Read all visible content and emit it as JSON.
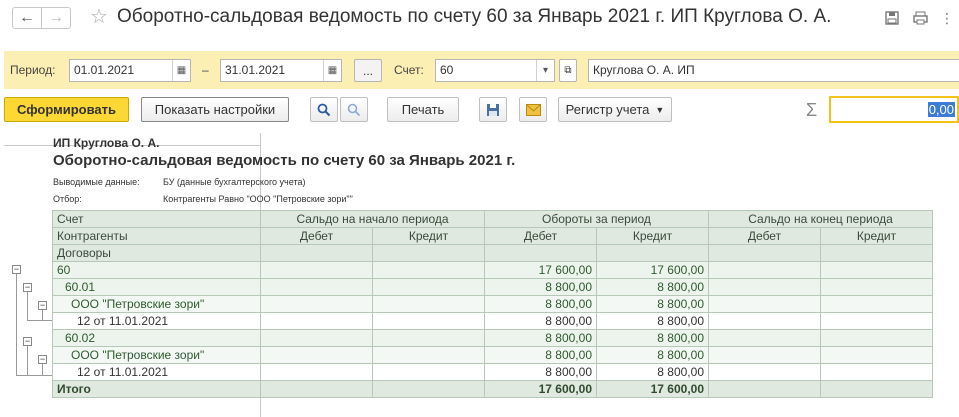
{
  "window": {
    "title": "Оборотно-сальдовая ведомость по счету 60 за Январь 2021 г. ИП Круглова О. А."
  },
  "params": {
    "period_label": "Период:",
    "date_from": "01.01.2021",
    "dash": "–",
    "date_to": "31.01.2021",
    "more_label": "...",
    "account_label": "Счет:",
    "account_value": "60",
    "organization": "Круглова О. А. ИП"
  },
  "toolbar": {
    "generate_label": "Сформировать",
    "show_settings_label": "Показать настройки",
    "print_label": "Печать",
    "register_label": "Регистр учета",
    "sum_value": "0,00"
  },
  "report": {
    "org": "ИП Круглова О. А.",
    "title": "Оборотно-сальдовая ведомость по счету 60 за Январь 2021 г.",
    "output_label": "Выводимые данные:",
    "output_value": "БУ (данные бухгалтерского учета)",
    "filter_label": "Отбор:",
    "filter_value": "Контрагенты Равно \"ООО \"Петровские зори\"\"",
    "headers": {
      "account": "Счет",
      "counterparties": "Контрагенты",
      "contracts": "Договоры",
      "opening": "Сальдо на начало периода",
      "turnover": "Обороты за период",
      "closing": "Сальдо на конец периода",
      "debit": "Дебет",
      "credit": "Кредит"
    },
    "rows": [
      {
        "label": "60",
        "debit_turn": "17 600,00",
        "credit_turn": "17 600,00"
      },
      {
        "label": "60.01",
        "debit_turn": "8 800,00",
        "credit_turn": "8 800,00"
      },
      {
        "label": "ООО \"Петровские зори\"",
        "debit_turn": "8 800,00",
        "credit_turn": "8 800,00"
      },
      {
        "label": "12 от 11.01.2021",
        "debit_turn": "8 800,00",
        "credit_turn": "8 800,00"
      },
      {
        "label": "60.02",
        "debit_turn": "8 800,00",
        "credit_turn": "8 800,00"
      },
      {
        "label": "ООО \"Петровские зори\"",
        "debit_turn": "8 800,00",
        "credit_turn": "8 800,00"
      },
      {
        "label": "12 от 11.01.2021",
        "debit_turn": "8 800,00",
        "credit_turn": "8 800,00"
      }
    ],
    "total": {
      "label": "Итого",
      "debit_turn": "17 600,00",
      "credit_turn": "17 600,00"
    }
  }
}
